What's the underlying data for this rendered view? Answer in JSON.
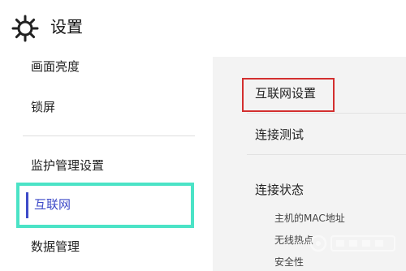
{
  "header": {
    "title": "设置",
    "icon": "gear-icon"
  },
  "sidebar": {
    "items": [
      {
        "label": "画面亮度"
      },
      {
        "label": "锁屏"
      },
      {
        "label": "监护管理设置"
      },
      {
        "label": "互联网",
        "selected": true
      },
      {
        "label": "数据管理"
      }
    ],
    "selected_outline_color": "#4be3c6",
    "selected_text_color": "#3d4ac8"
  },
  "content": {
    "items": [
      {
        "label": "互联网设置"
      },
      {
        "label": "连接测试"
      },
      {
        "label": "连接状态"
      }
    ],
    "status_details": [
      {
        "label": "主机的MAC地址"
      },
      {
        "label": "无线热点"
      },
      {
        "label": "安全性"
      }
    ],
    "annotation_color": "#d32f2f"
  }
}
